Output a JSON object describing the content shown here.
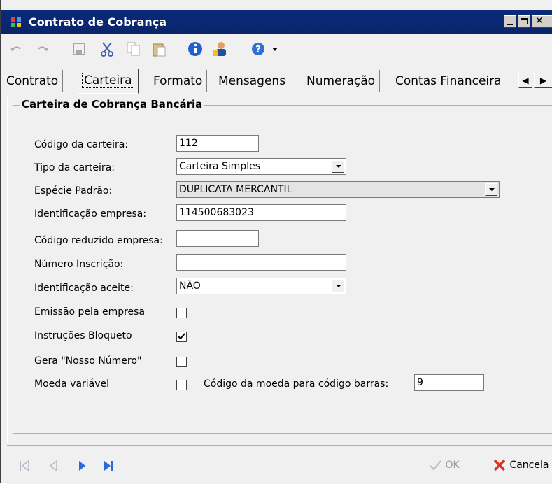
{
  "window": {
    "title": "Contrato de Cobrança"
  },
  "tabs": [
    {
      "label": "Contrato",
      "active": false
    },
    {
      "label": "Carteira",
      "active": true
    },
    {
      "label": "Formato",
      "active": false
    },
    {
      "label": "Mensagens",
      "active": false
    },
    {
      "label": "Numeração",
      "active": false
    },
    {
      "label": "Contas Financeira",
      "active": false
    }
  ],
  "group": {
    "title": "Carteira de Cobrança Bancária"
  },
  "form": {
    "codigo_carteira": {
      "label": "Código da carteira:",
      "value": "112"
    },
    "tipo_carteira": {
      "label": "Tipo da carteira:",
      "value": "Carteira Simples"
    },
    "especie_padrao": {
      "label": "Espécie Padrão:",
      "value": "DUPLICATA MERCANTIL"
    },
    "identificacao_empresa": {
      "label": "Identificação empresa:",
      "value": "114500683023"
    },
    "codigo_reduzido": {
      "label": "Código reduzido empresa:",
      "value": ""
    },
    "numero_inscricao": {
      "label": "Número Inscrição:",
      "value": ""
    },
    "identificacao_aceite": {
      "label": "Identificação aceite:",
      "value": "NÃO"
    },
    "emissao_empresa": {
      "label": "Emissão pela empresa",
      "checked": false
    },
    "instrucoes_bloqueto": {
      "label": "Instruções Bloqueto",
      "checked": true
    },
    "gera_nosso_numero": {
      "label": "Gera \"Nosso Número\"",
      "checked": false
    },
    "moeda_variavel": {
      "label": "Moeda variável",
      "checked": false
    },
    "codigo_moeda": {
      "label": "Código da moeda para código barras:",
      "value": "9"
    }
  },
  "footer": {
    "ok_label": "OK",
    "cancel_label": "Cancela"
  }
}
